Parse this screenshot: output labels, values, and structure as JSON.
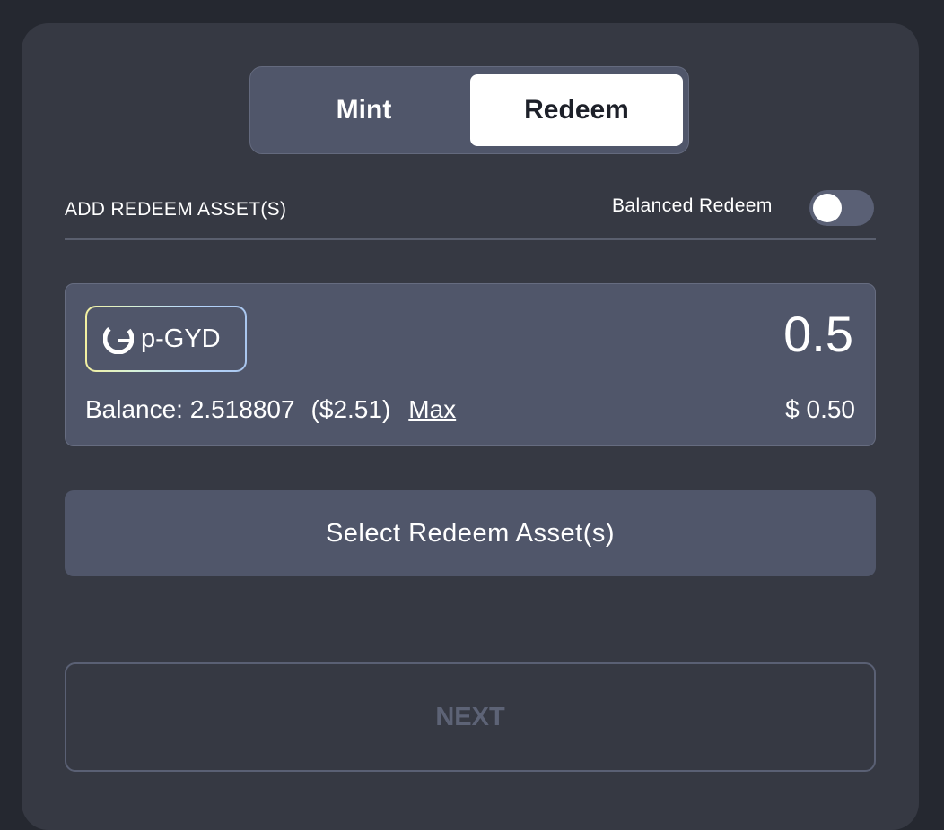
{
  "tabs": [
    {
      "label": "Mint",
      "active": false
    },
    {
      "label": "Redeem",
      "active": true
    }
  ],
  "section": {
    "label": "ADD REDEEM ASSET(S)"
  },
  "balanced_redeem": {
    "label": "Balanced Redeem",
    "enabled": false
  },
  "asset": {
    "token_name": "p-GYD",
    "icon": "gyroscope-logo-icon",
    "amount": "0.5",
    "balance_label": "Balance: ",
    "balance_value": "2.518807",
    "balance_usd": "($2.51)",
    "max_label": "Max",
    "usd_value": "$ 0.50"
  },
  "select_button": {
    "label": "Select Redeem Asset(s)"
  },
  "next_button": {
    "label": "NEXT",
    "disabled": true
  },
  "colors": {
    "background": "#252830",
    "card": "#363943",
    "panel": "#50566a",
    "active_tab": "#ffffff",
    "disabled_text": "#5d6376"
  }
}
